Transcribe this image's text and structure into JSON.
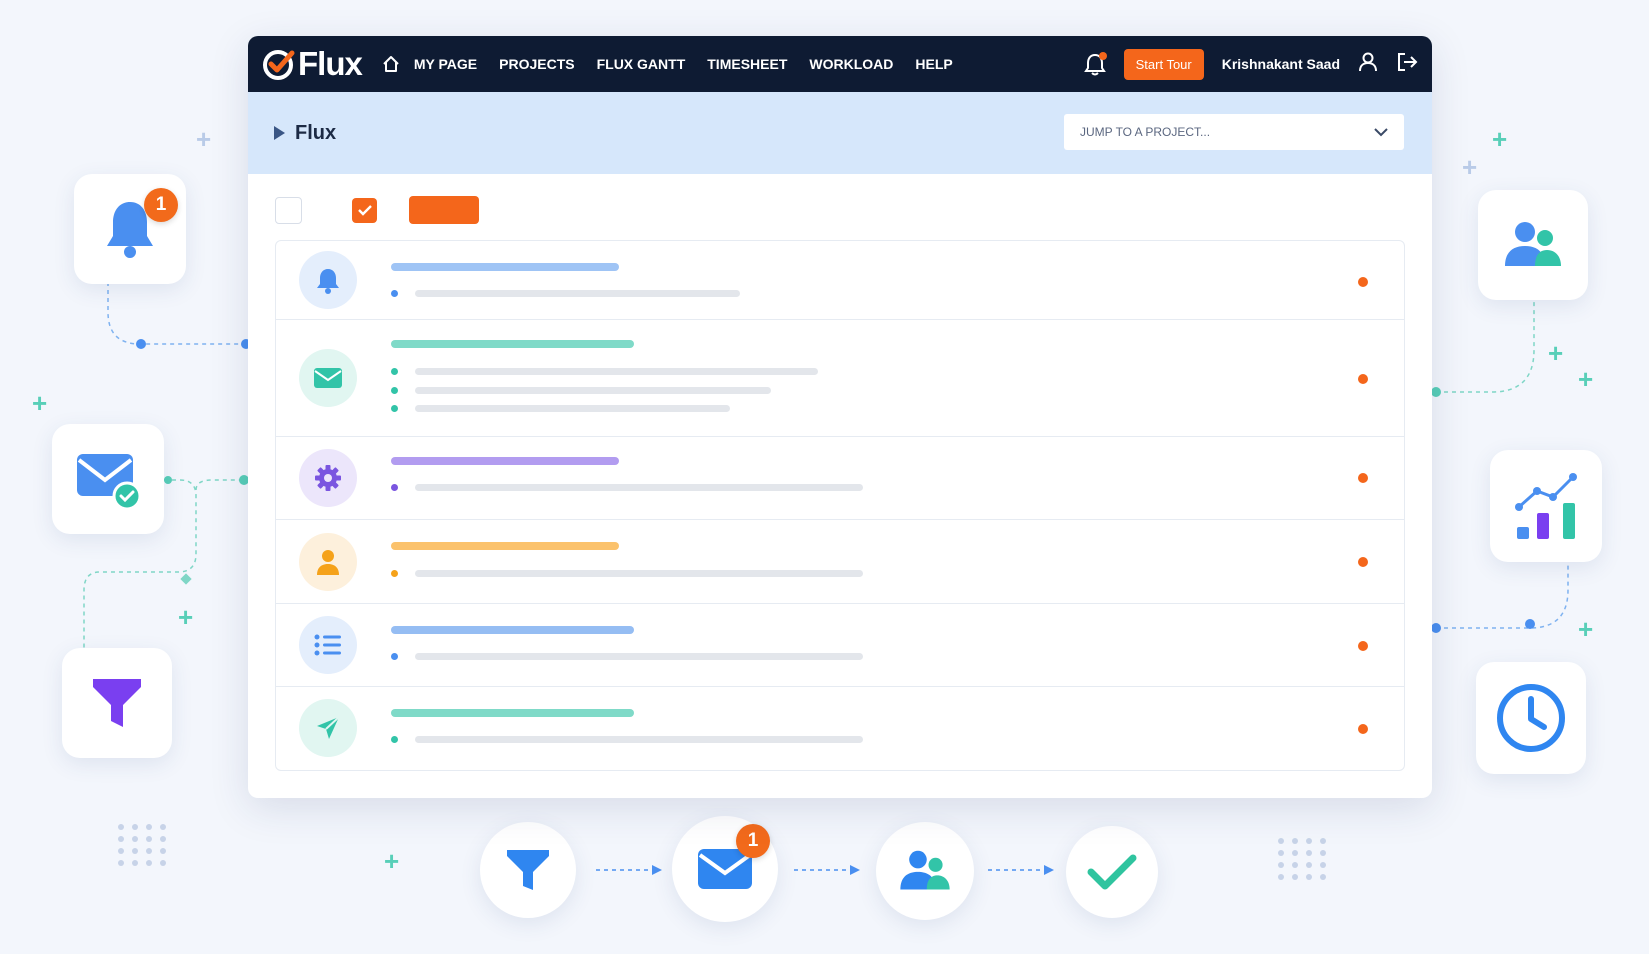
{
  "app": {
    "logo": "Flux",
    "nav": [
      "MY PAGE",
      "PROJECTS",
      "FLUX GANTT",
      "TIMESHEET",
      "WORKLOAD",
      "HELP"
    ],
    "tour_button": "Start Tour",
    "user_name": "Krishnakant Saad",
    "breadcrumb_title": "Flux",
    "jump_placeholder": "JUMP TO A PROJECT..."
  },
  "floating_cards": {
    "notifications_badge": "1",
    "flow_mail_badge": "1"
  },
  "rows": [
    {
      "icon": "bell-icon",
      "color": "#4a8ff0",
      "bg": "#e4eefc",
      "title_color": "#9fc4f5"
    },
    {
      "icon": "mail-icon",
      "color": "#32c4a8",
      "bg": "#e1f6f1",
      "title_color": "#7fdac8"
    },
    {
      "icon": "gear-icon",
      "color": "#7a55e0",
      "bg": "#ece6fb",
      "title_color": "#b29cf0"
    },
    {
      "icon": "user-icon",
      "color": "#f5a21a",
      "bg": "#fdf0dc",
      "title_color": "#fbc26c"
    },
    {
      "icon": "list-icon",
      "color": "#4a8ff0",
      "bg": "#e4eefc",
      "title_color": "#95bdf3"
    },
    {
      "icon": "send-icon",
      "color": "#32c4a8",
      "bg": "#e1f6f1",
      "title_color": "#7fdac8"
    }
  ],
  "colors": {
    "accent": "#f4661b",
    "navbar": "#0e1b33",
    "subbar": "#d6e7fb"
  }
}
